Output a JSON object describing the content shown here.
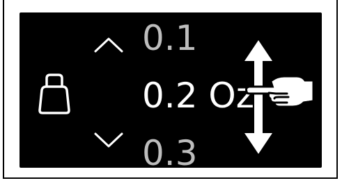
{
  "display": {
    "value_prev": "0.1",
    "value_current": "0.2 Oz",
    "value_next": "0.3"
  },
  "icons": {
    "weight": "weight-icon",
    "scroll_up": "chevron-up-icon",
    "scroll_down": "chevron-down-icon",
    "swipe_arrow": "vertical-double-arrow-icon",
    "hand": "pointing-hand-icon"
  },
  "colors": {
    "screen_background": "#000000",
    "text_primary": "#ffffff",
    "text_faded": "#bdbdbd"
  }
}
